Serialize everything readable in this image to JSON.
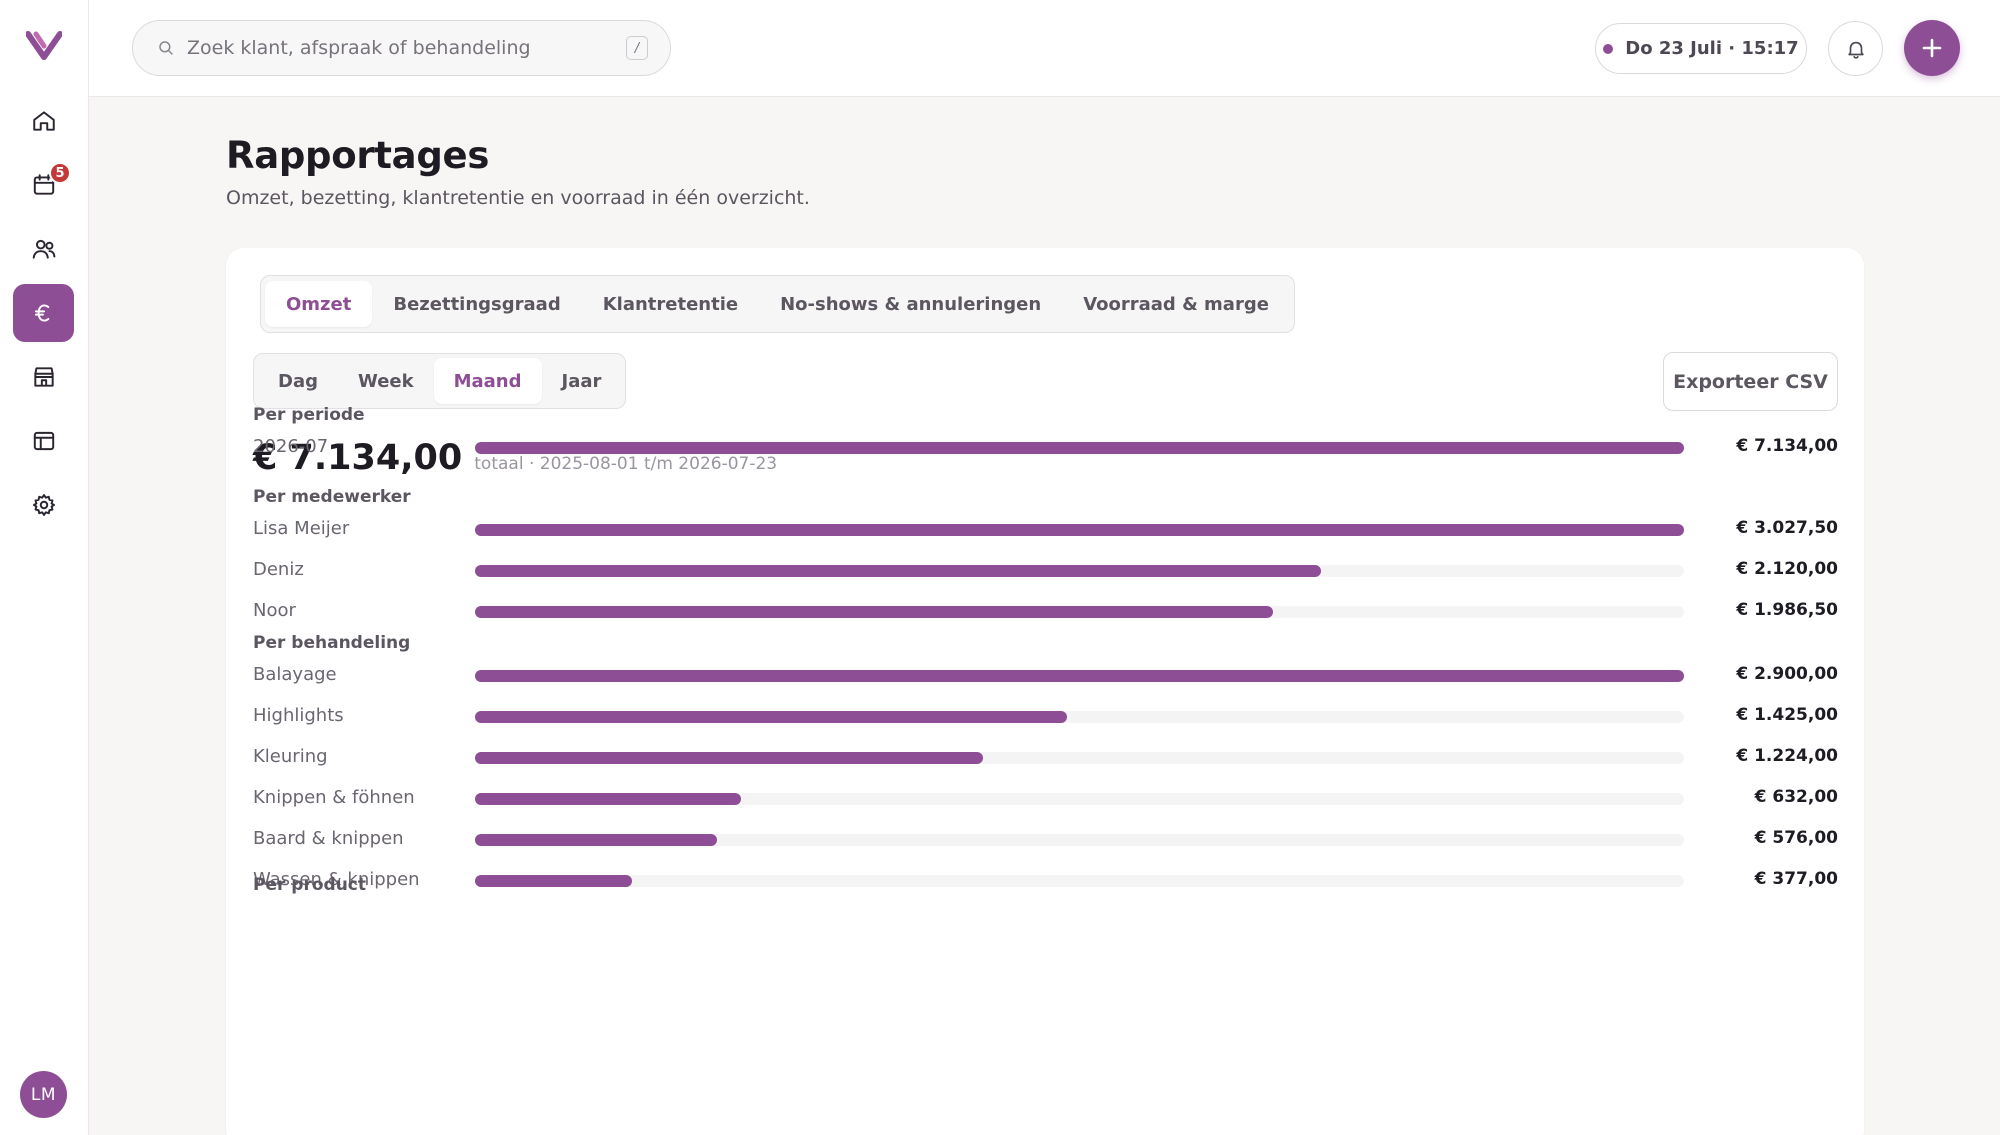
{
  "sidebar": {
    "logo": "brand-logo",
    "items": [
      {
        "name": "home",
        "icon": "home-icon",
        "badge": ""
      },
      {
        "name": "calendar",
        "icon": "calendar-icon",
        "badge": "5"
      },
      {
        "name": "clients",
        "icon": "users-icon",
        "badge": ""
      },
      {
        "name": "reports",
        "icon": "euro-icon",
        "badge": "",
        "active": true
      },
      {
        "name": "store",
        "icon": "store-icon",
        "badge": ""
      },
      {
        "name": "layout",
        "icon": "layout-icon",
        "badge": ""
      },
      {
        "name": "settings",
        "icon": "gear-icon",
        "badge": ""
      }
    ],
    "avatar": "LM"
  },
  "topbar": {
    "search_placeholder": "Zoek klant, afspraak of behandeling",
    "search_shortcut": "/",
    "datetime": "Do 23 Juli · 15:17"
  },
  "page": {
    "title": "Rapportages",
    "subtitle": "Omzet, bezetting, klantretentie en voorraad in één overzicht."
  },
  "tabs": [
    "Omzet",
    "Bezettingsgraad",
    "Klantretentie",
    "No-shows & annuleringen",
    "Voorraad & marge"
  ],
  "active_tab": 0,
  "periods": [
    "Dag",
    "Week",
    "Maand",
    "Jaar"
  ],
  "active_period": 2,
  "export_label": "Exporteer CSV",
  "total": {
    "amount": "€ 7.134,00",
    "range": "totaal · 2025-08-01 t/m 2026-07-23"
  },
  "sections": [
    {
      "title": "Per periode",
      "rows": [
        {
          "label": "2026-07",
          "value": "€ 7.134,00",
          "fraction": 1.0
        }
      ]
    },
    {
      "title": "Per medewerker",
      "rows": [
        {
          "label": "Lisa Meijer",
          "value": "€ 3.027,50",
          "fraction": 1.0
        },
        {
          "label": "Deniz",
          "value": "€ 2.120,00",
          "fraction": 0.7
        },
        {
          "label": "Noor",
          "value": "€ 1.986,50",
          "fraction": 0.66
        }
      ]
    },
    {
      "title": "Per behandeling",
      "rows": [
        {
          "label": "Balayage",
          "value": "€ 2.900,00",
          "fraction": 1.0
        },
        {
          "label": "Highlights",
          "value": "€ 1.425,00",
          "fraction": 0.49
        },
        {
          "label": "Kleuring",
          "value": "€ 1.224,00",
          "fraction": 0.42
        },
        {
          "label": "Knippen & föhnen",
          "value": "€ 632,00",
          "fraction": 0.22
        },
        {
          "label": "Baard & knippen",
          "value": "€ 576,00",
          "fraction": 0.2
        },
        {
          "label": "Wassen & knippen",
          "value": "€ 377,00",
          "fraction": 0.13
        }
      ]
    },
    {
      "title": "Per product",
      "rows": []
    }
  ],
  "colors": {
    "accent": "#8e4e96",
    "badge": "#c43838"
  }
}
